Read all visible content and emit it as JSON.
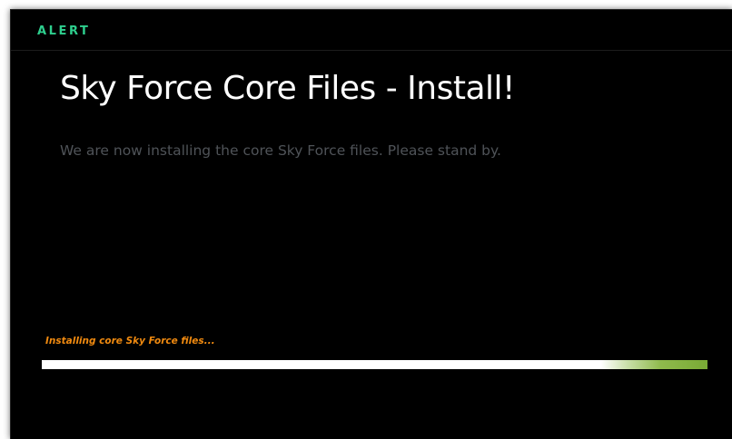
{
  "header": {
    "brand": "ALERT"
  },
  "main": {
    "title": "Sky Force Core Files - Install!",
    "subtitle": "We are now installing the core Sky Force files. Please stand by."
  },
  "progress": {
    "status": "Installing core Sky Force files...",
    "value_percent": 100
  },
  "colors": {
    "brand": "#2ecf8e",
    "background": "#000000",
    "title": "#ffffff",
    "subtitle": "#4f5358",
    "status": "#f08a10",
    "progress_fill": "#ffffff",
    "progress_accent": "#79aa35"
  }
}
